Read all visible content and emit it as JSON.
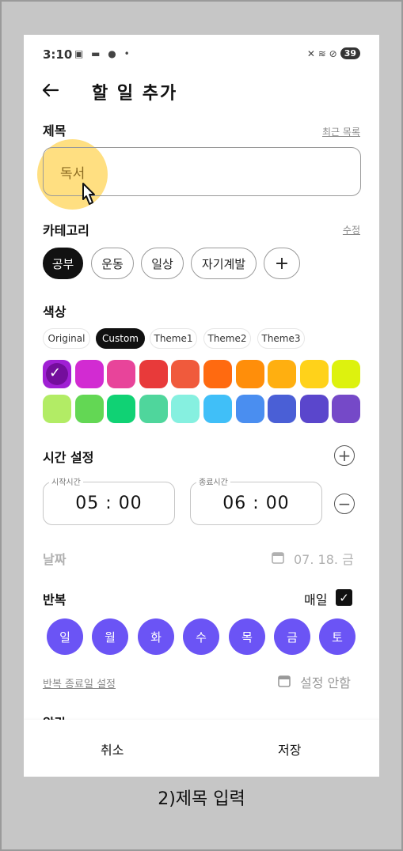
{
  "status_bar": {
    "time": "3:10",
    "left_icons": "▣ ▬ ● •",
    "right_icons": "✕ ≋ ⊘",
    "battery": "39"
  },
  "header": {
    "title": "할 일 추가"
  },
  "title_section": {
    "label": "제목",
    "recent_link": "최근 목록",
    "value": "독서"
  },
  "category_section": {
    "label": "카테고리",
    "edit_link": "수정",
    "chips": [
      "공부",
      "운동",
      "일상",
      "자기계발"
    ],
    "selected": "공부",
    "add_symbol": "+"
  },
  "color_section": {
    "label": "색상",
    "themes": [
      "Original",
      "Custom",
      "Theme1",
      "Theme2",
      "Theme3"
    ],
    "selected_theme": "Custom",
    "colors_row1": [
      "#a020d4",
      "#d22bd2",
      "#e8449a",
      "#e83a3a",
      "#f05a3c",
      "#ff6a10",
      "#ff8e0a",
      "#ffaf10",
      "#ffd21a",
      "#ddf20e"
    ],
    "colors_row2": [
      "#b2ec65",
      "#63d754",
      "#10d274",
      "#4fd69c",
      "#86f0e0",
      "#40bff8",
      "#4a8ef0",
      "#4a5fd6",
      "#5a46cc",
      "#7549c8"
    ],
    "selected_color": "#a020d4",
    "check": "✓"
  },
  "time_section": {
    "label": "시간 설정",
    "start_caption": "시작시간",
    "start_time": "05 : 00",
    "end_caption": "종료시간",
    "end_time": "06 : 00",
    "add_symbol": "+",
    "remove_symbol": "−"
  },
  "date_section": {
    "label": "날짜",
    "value": "07. 18. 금"
  },
  "repeat_section": {
    "label": "반복",
    "daily_label": "매일",
    "daily_checked": true,
    "check": "✓",
    "days": [
      "일",
      "월",
      "화",
      "수",
      "목",
      "금",
      "토"
    ],
    "end_link": "반복 종료일 설정",
    "end_value": "설정 안함"
  },
  "alarm_section": {
    "label": "알람"
  },
  "bottom": {
    "cancel": "취소",
    "save": "저장"
  },
  "caption": "2)제목 입력"
}
